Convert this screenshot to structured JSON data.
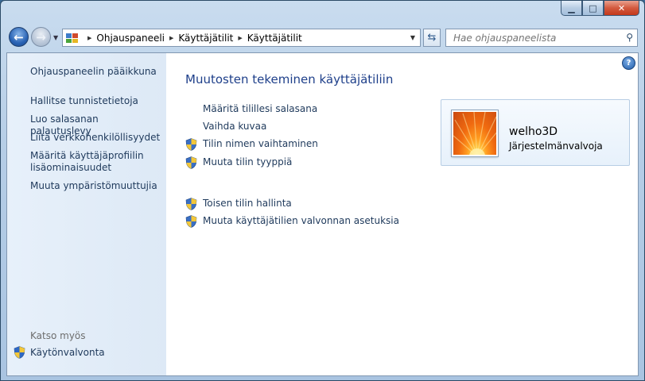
{
  "window": {
    "caption": {
      "minimize": "▁",
      "maximize": "□",
      "close": "✕"
    },
    "colors": {
      "title_gradient": "#b5cde6",
      "link": "#1e395b",
      "heading": "#1e3f8a"
    }
  },
  "address_bar": {
    "icon": "control-panel-icon",
    "segments": [
      "Ohjauspaneeli",
      "Käyttäjätilit",
      "Käyttäjätilit"
    ]
  },
  "search": {
    "placeholder": "Hae ohjauspaneelista",
    "icon": "search-icon"
  },
  "sidebar": {
    "home": "Ohjauspaneelin pääikkuna",
    "links": [
      "Hallitse tunnistetietoja",
      "Luo salasanan palautuslevy",
      "Liitä verkkohenkilöllisyydet",
      "Määritä käyttäjäprofiilin lisäominaisuudet",
      "Muuta ympäristömuuttujia"
    ],
    "see_also_heading": "Katso myös",
    "see_also_link": "Käytönvalvonta"
  },
  "main": {
    "title": "Muutosten tekeminen käyttäjätiliin",
    "tasks": [
      {
        "label": "Määritä tilillesi salasana",
        "shield": false
      },
      {
        "label": "Vaihda kuvaa",
        "shield": false
      },
      {
        "label": "Tilin nimen vaihtaminen",
        "shield": true
      },
      {
        "label": "Muuta tilin tyyppiä",
        "shield": true
      }
    ],
    "tasks_other": [
      {
        "label": "Toisen tilin hallinta",
        "shield": true
      },
      {
        "label": "Muuta käyttäjätilien valvonnan asetuksia",
        "shield": true
      }
    ]
  },
  "user": {
    "name": "welho3D",
    "role": "Järjestelmänvalvoja",
    "picture": "orange-flower-picture"
  }
}
